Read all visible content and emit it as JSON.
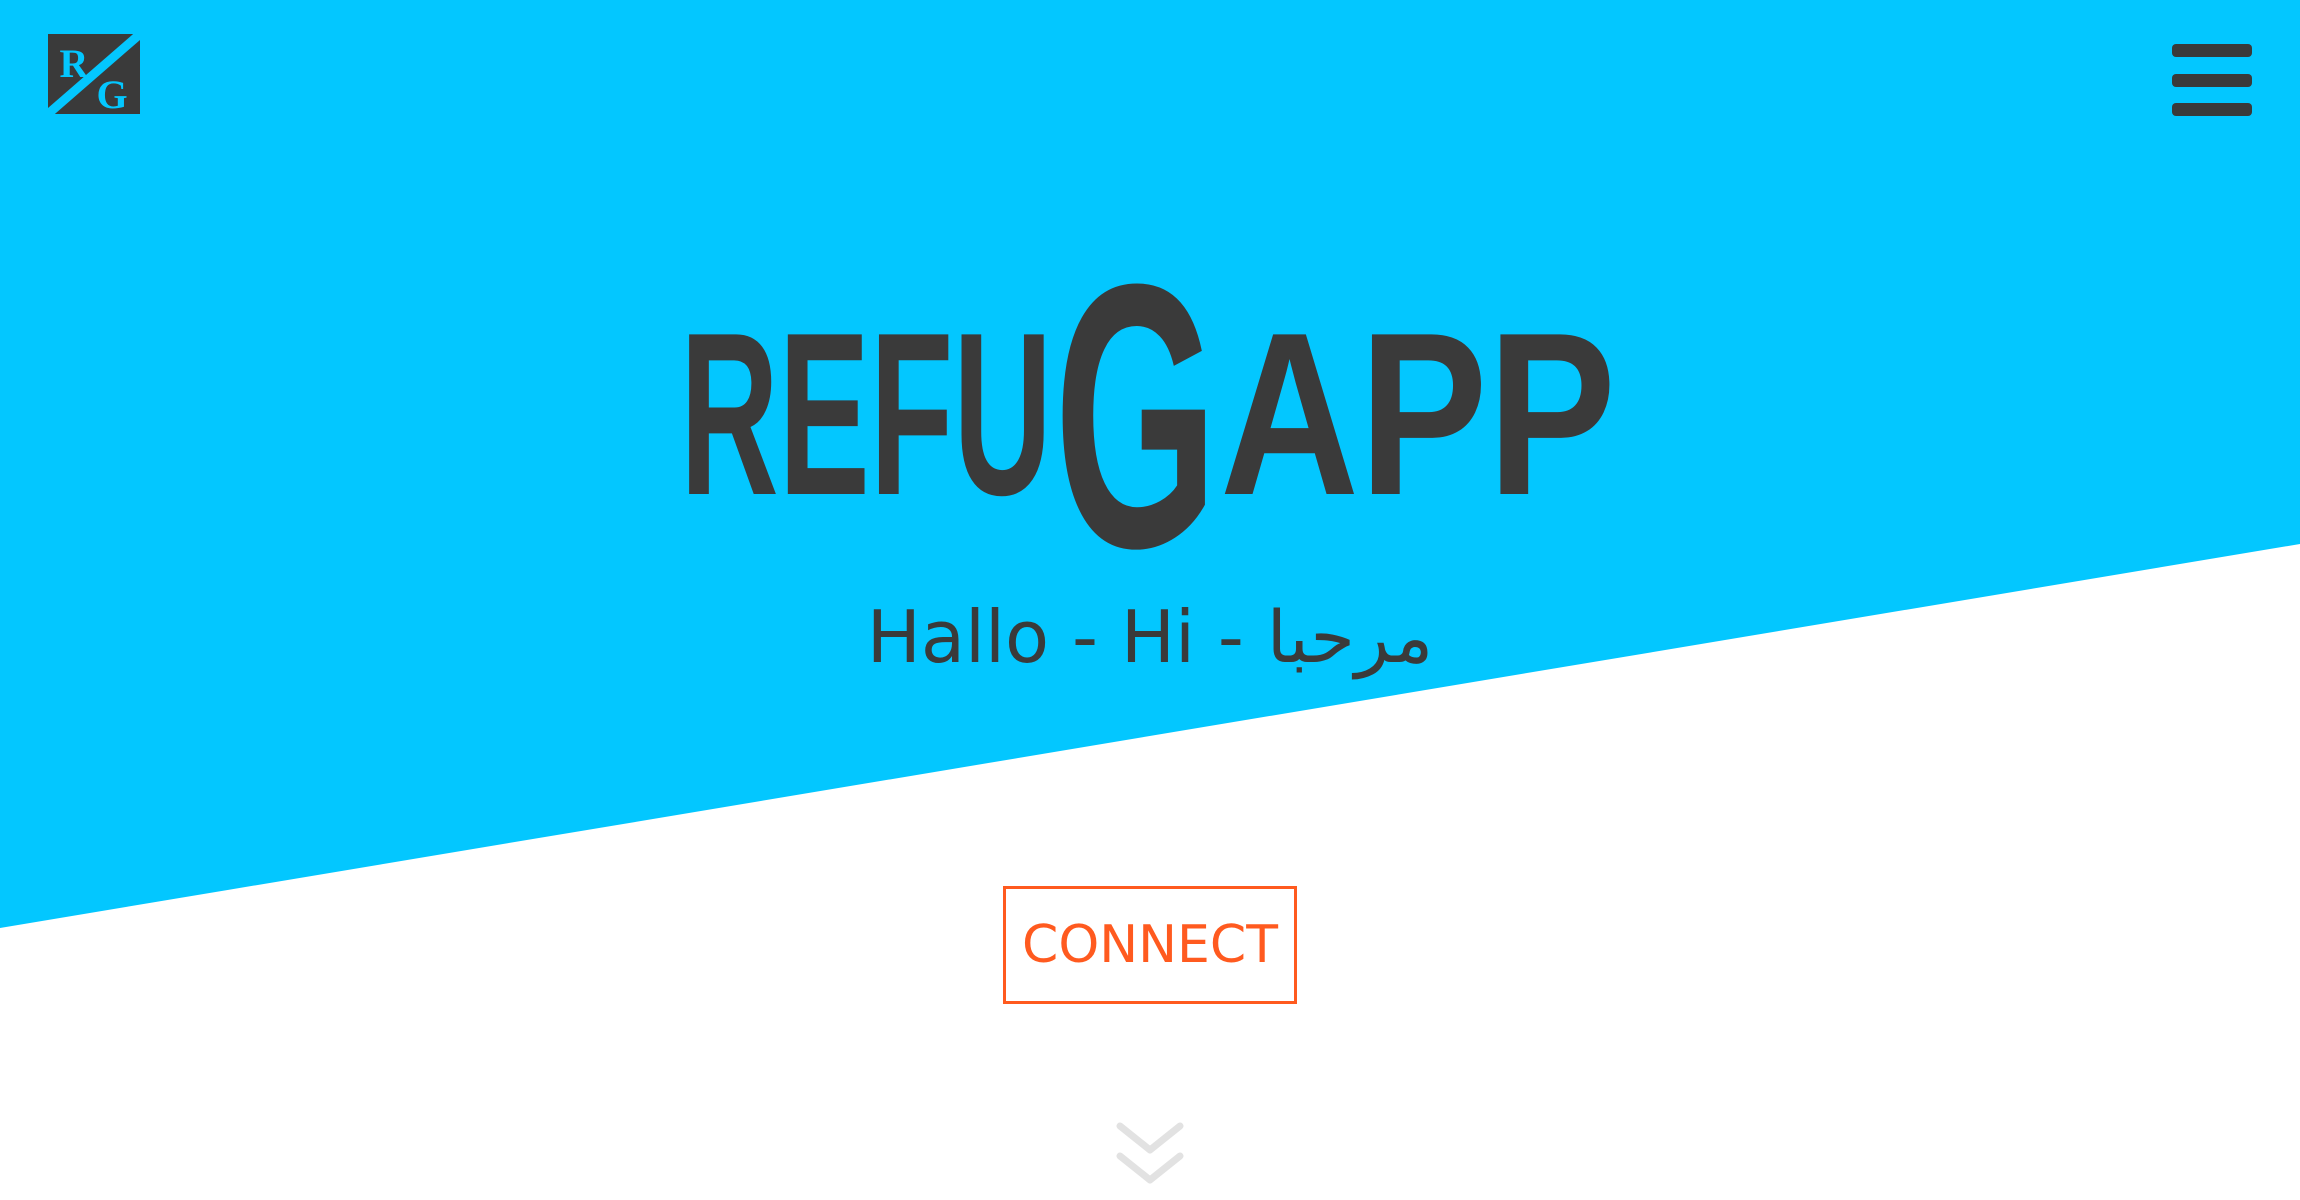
{
  "colors": {
    "hero_blue": "#03c7ff",
    "background": "#ffffff",
    "dark_text": "#3a3a3a",
    "accent_orange": "#ff5a1f",
    "chevron_grey": "#e2e2e2"
  },
  "header": {
    "logo_text": "RG",
    "logo_icon": "rg-logo-icon",
    "menu_icon": "hamburger-menu-icon"
  },
  "hero": {
    "title_before": "REFU",
    "title_big": "G",
    "title_after": "APP",
    "greeting": "Hallo - Hi - مرحبا"
  },
  "cta": {
    "connect_label": "CONNECT"
  },
  "scroll": {
    "icon": "double-chevron-down-icon"
  }
}
